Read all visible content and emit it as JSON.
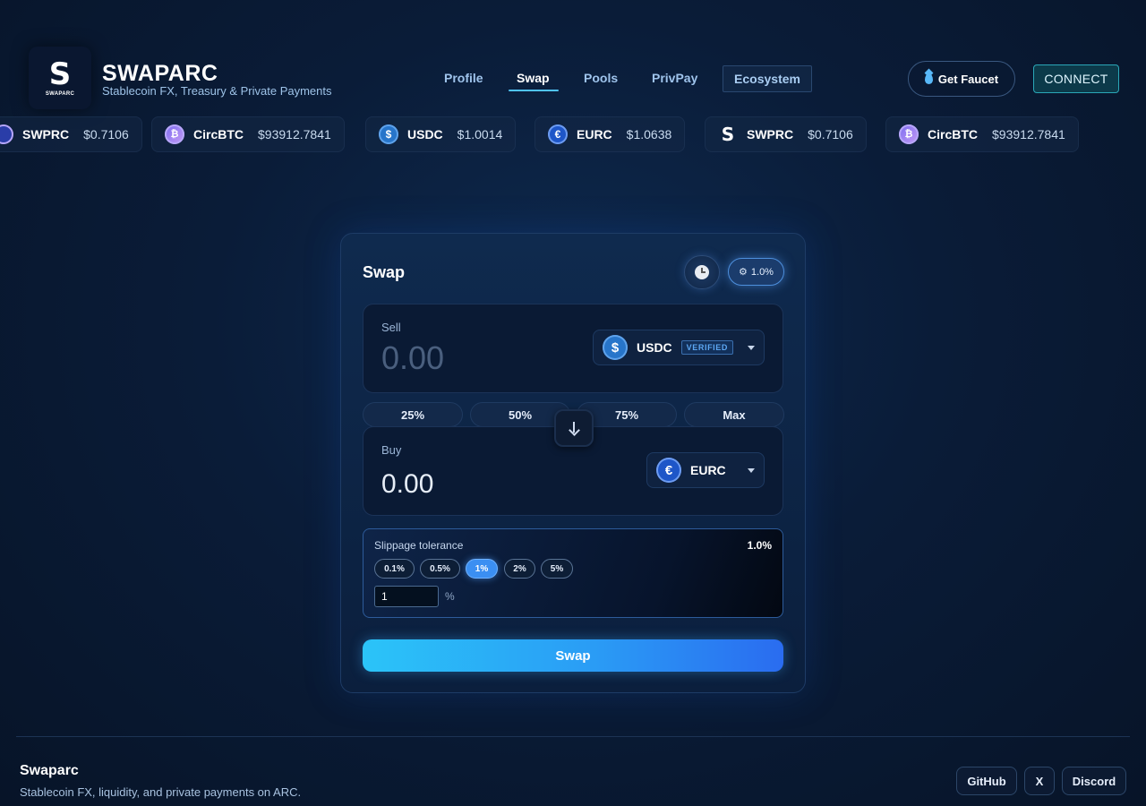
{
  "brand": {
    "logo_letter": "S",
    "logo_mini": "SWAPARC",
    "title": "SWAPARC",
    "subtitle": "Stablecoin FX, Treasury & Private Payments"
  },
  "nav": {
    "items": [
      "Profile",
      "Swap",
      "Pools",
      "PrivPay",
      "Ecosystem"
    ],
    "active": "Swap"
  },
  "header_actions": {
    "faucet_label": "Get Faucet",
    "connect_label": "CONNECT"
  },
  "ticker": [
    {
      "symbol": "SWPRC",
      "price": "$0.7106",
      "icon": "swprc-icon"
    },
    {
      "symbol": "CircBTC",
      "price": "$93912.7841",
      "icon": "circbtc-icon"
    },
    {
      "symbol": "USDC",
      "price": "$1.0014",
      "icon": "usdc-icon"
    },
    {
      "symbol": "EURC",
      "price": "$1.0638",
      "icon": "eurc-icon"
    },
    {
      "symbol": "SWPRC",
      "price": "$0.7106",
      "icon": "swprc-icon"
    },
    {
      "symbol": "CircBTC",
      "price": "$93912.7841",
      "icon": "circbtc-icon"
    }
  ],
  "swap": {
    "title": "Swap",
    "slippage_badge": "1.0%",
    "sell": {
      "label": "Sell",
      "placeholder": "0.00",
      "token": "USDC",
      "token_badge": "VERIFIED"
    },
    "percent_buttons": [
      "25%",
      "50%",
      "75%",
      "Max"
    ],
    "buy": {
      "label": "Buy",
      "value": "0.00",
      "token": "EURC"
    },
    "slippage": {
      "label": "Slippage tolerance",
      "current": "1.0%",
      "options": [
        "0.1%",
        "0.5%",
        "1%",
        "2%",
        "5%"
      ],
      "active": "1%",
      "custom_value": "1",
      "unit": "%"
    },
    "submit_label": "Swap"
  },
  "footer": {
    "title": "Swaparc",
    "subtitle": "Stablecoin FX, liquidity, and private payments on ARC.",
    "links": [
      "GitHub",
      "X",
      "Discord"
    ]
  },
  "colors": {
    "accent": "#2a9cf5",
    "connect_border": "#2aa7b8",
    "usdc": "#2775ca",
    "eurc": "#1e56c8"
  }
}
